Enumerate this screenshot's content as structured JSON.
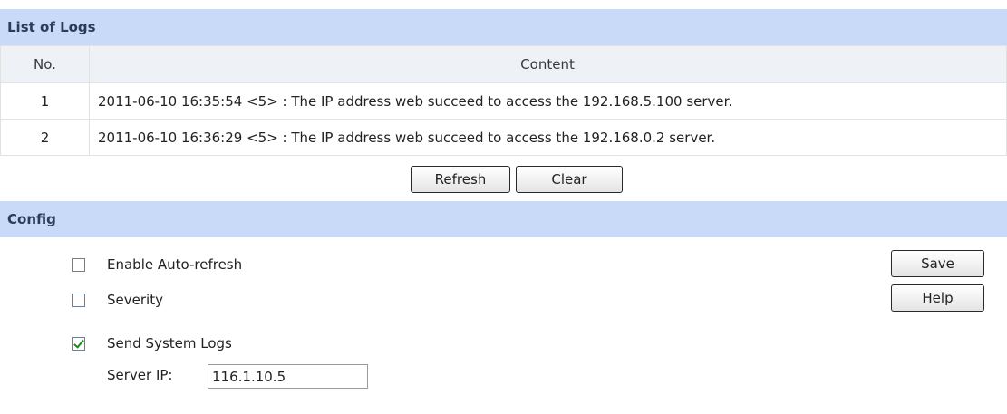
{
  "logs": {
    "header": "List of Logs",
    "columns": {
      "no": "No.",
      "content": "Content"
    },
    "rows": [
      {
        "no": "1",
        "content": "2011-06-10 16:35:54 <5> : The IP address web succeed to access the 192.168.5.100 server."
      },
      {
        "no": "2",
        "content": "2011-06-10 16:36:29 <5> : The IP address web succeed to access the 192.168.0.2 server."
      }
    ],
    "refresh_label": "Refresh",
    "clear_label": "Clear"
  },
  "config": {
    "header": "Config",
    "auto_refresh": {
      "label": "Enable Auto-refresh",
      "checked": false
    },
    "severity": {
      "label": "Severity",
      "checked": false
    },
    "send_logs": {
      "label": "Send System Logs",
      "checked": true
    },
    "server_ip_label": "Server IP:",
    "server_ip_value": "116.1.10.5",
    "save_label": "Save",
    "help_label": "Help"
  }
}
